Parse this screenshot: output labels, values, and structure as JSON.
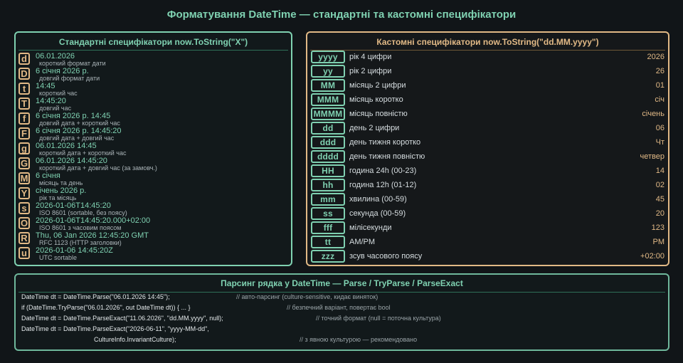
{
  "title": "Форматування DateTime — стандартні та кастомні специфікатори",
  "standard": {
    "heading": "Стандартні специфікатори  now.ToString(\"X\")",
    "items": [
      {
        "key": "d",
        "value": "06.01.2026",
        "desc": "короткий формат дати"
      },
      {
        "key": "D",
        "value": "6 січня 2026 р.",
        "desc": "довгий формат дати"
      },
      {
        "key": "t",
        "value": "14:45",
        "desc": "короткий час"
      },
      {
        "key": "T",
        "value": "14:45:20",
        "desc": "довгий час"
      },
      {
        "key": "f",
        "value": "6 січня 2026 р. 14:45",
        "desc": "довгий дата + короткий час"
      },
      {
        "key": "F",
        "value": "6 січня 2026 р. 14:45:20",
        "desc": "довгий дата + довгий час"
      },
      {
        "key": "g",
        "value": "06.01.2026 14:45",
        "desc": "короткий дата + короткий час"
      },
      {
        "key": "G",
        "value": "06.01.2026 14:45:20",
        "desc": "короткий дата + довгий час (за замовч.)"
      },
      {
        "key": "M",
        "value": "6 січня",
        "desc": "місяць та день"
      },
      {
        "key": "Y",
        "value": "січень 2026 р.",
        "desc": "рік та місяць"
      },
      {
        "key": "s",
        "value": "2026-01-06T14:45:20",
        "desc": "ISO 8601 (sortable, без поясу)"
      },
      {
        "key": "O",
        "value": "2026-01-06T14:45:20.000+02:00",
        "desc": "ISO 8601 з часовим поясом"
      },
      {
        "key": "R",
        "value": "Thu, 06 Jan 2026 12:45:20 GMT",
        "desc": "RFC 1123 (HTTP заголовки)"
      },
      {
        "key": "u",
        "value": "2026-01-06 14:45:20Z",
        "desc": "UTC sortable"
      }
    ]
  },
  "custom": {
    "heading": "Кастомні специфікатори  now.ToString(\"dd.MM.yyyy\")",
    "items": [
      {
        "key": "yyyy",
        "desc": "рік 4 цифри",
        "value": "2026"
      },
      {
        "key": "yy",
        "desc": "рік 2 цифри",
        "value": "26"
      },
      {
        "key": "MM",
        "desc": "місяць 2 цифри",
        "value": "01"
      },
      {
        "key": "MMM",
        "desc": "місяць коротко",
        "value": "січ"
      },
      {
        "key": "MMMM",
        "desc": "місяць повністю",
        "value": "січень"
      },
      {
        "key": "dd",
        "desc": "день 2 цифри",
        "value": "06"
      },
      {
        "key": "ddd",
        "desc": "день тижня коротко",
        "value": "Чт"
      },
      {
        "key": "dddd",
        "desc": "день тижня повністю",
        "value": "четвер"
      },
      {
        "key": "HH",
        "desc": "година 24h (00-23)",
        "value": "14"
      },
      {
        "key": "hh",
        "desc": "година 12h (01-12)",
        "value": "02"
      },
      {
        "key": "mm",
        "desc": "хвилина (00-59)",
        "value": "45"
      },
      {
        "key": "ss",
        "desc": "секунда (00-59)",
        "value": "20"
      },
      {
        "key": "fff",
        "desc": "мілісекунди",
        "value": "123"
      },
      {
        "key": "tt",
        "desc": "AM/PM",
        "value": "PM"
      },
      {
        "key": "zzz",
        "desc": "зсув часового поясу",
        "value": "+02:00"
      }
    ]
  },
  "parse": {
    "heading": "Парсинг рядка у DateTime — Parse / TryParse / ParseExact",
    "lines": [
      {
        "code": "DateTime dt = DateTime.Parse(\"06.01.2026 14:45\");",
        "comment": "// авто-парсинг (culture-sensitive, кидає виняток)"
      },
      {
        "code": "if (DateTime.TryParse(\"06.01.2026\", out DateTime dt)) { ... }",
        "comment": "// безпечний варіант, повертає bool"
      },
      {
        "code": "DateTime dt = DateTime.ParseExact(\"11.06.2026\", \"dd.MM.yyyy\", null);",
        "comment": "// точний формат (null = поточна культура)"
      },
      {
        "code": "DateTime dt = DateTime.ParseExact(\"2026-06-11\", \"yyyy-MM-dd\",",
        "comment": ""
      },
      {
        "code": "CultureInfo.InvariantCulture);",
        "comment": "// з явною культурою — рекомендовано"
      }
    ]
  }
}
